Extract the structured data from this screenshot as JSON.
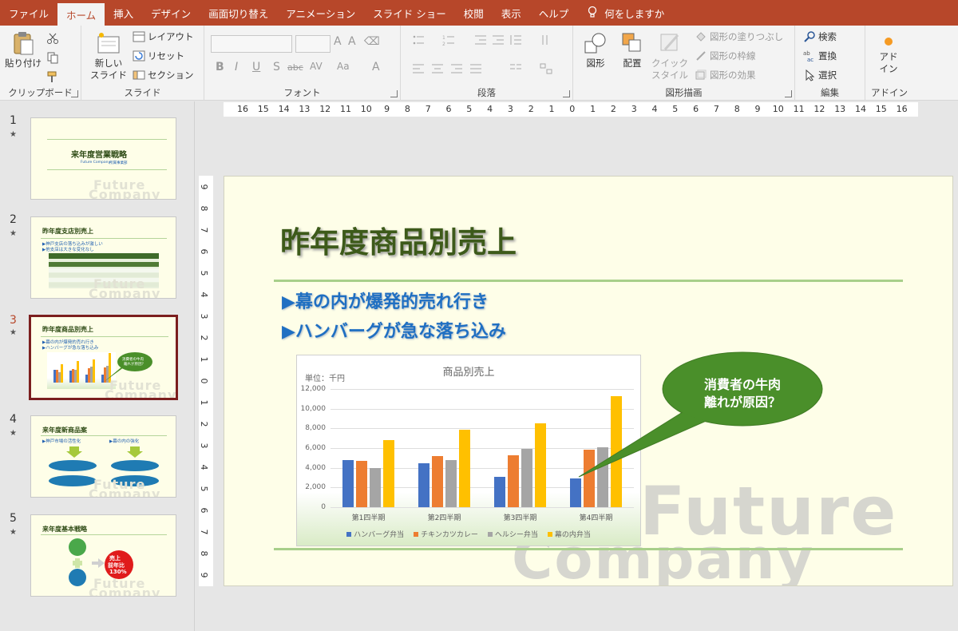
{
  "menu": {
    "tabs": [
      "ファイル",
      "ホーム",
      "挿入",
      "デザイン",
      "画面切り替え",
      "アニメーション",
      "スライド ショー",
      "校閲",
      "表示",
      "ヘルプ"
    ],
    "tell_me": "何をしますか"
  },
  "ribbon": {
    "clipboard": {
      "paste": "貼り付け",
      "label": "クリップボード"
    },
    "slides": {
      "new_slide_line1": "新しい",
      "new_slide_line2": "スライド",
      "layout": "レイアウト",
      "reset": "リセット",
      "section": "セクション",
      "label": "スライド"
    },
    "font": {
      "label": "フォント",
      "bold": "B",
      "italic": "I",
      "underline": "U",
      "shadow": "S",
      "strike": "abc",
      "spacing": "AV",
      "case": "Aa",
      "color": "A"
    },
    "paragraph": {
      "label": "段落"
    },
    "drawing": {
      "shapes": "図形",
      "arrange": "配置",
      "quick_line1": "クイック",
      "quick_line2": "スタイル",
      "fill": "図形の塗りつぶし",
      "outline": "図形の枠線",
      "effects": "図形の効果",
      "label": "図形描画"
    },
    "editing": {
      "find": "検索",
      "replace": "置換",
      "select": "選択",
      "label": "編集"
    },
    "addins": {
      "line1": "アド",
      "line2": "イン",
      "label": "アドイン"
    }
  },
  "thumbnails": [
    {
      "num": "1",
      "star": "★",
      "title": "来年度営業戦略",
      "sub1": "Future Company",
      "sub2": "所属事業部"
    },
    {
      "num": "2",
      "star": "★",
      "title": "昨年度支店別売上",
      "b1": "▶神戸支店の落ち込みが激しい",
      "b2": "▶他支店は大きな変化なし"
    },
    {
      "num": "3",
      "star": "★",
      "title": "昨年度商品別売上",
      "b1": "▶幕の内が爆発的売れ行き",
      "b2": "▶ハンバーグが急な落ち込み",
      "callout1": "消費者の牛肉",
      "callout2": "離れが原因？"
    },
    {
      "num": "4",
      "star": "★",
      "title": "来年度新商品案",
      "b1": "▶神戸市場の活性化",
      "b2": "▶幕の内の強化"
    },
    {
      "num": "5",
      "star": "★",
      "title": "来年度基本戦略",
      "circle1": "売上",
      "circle2": "前年比",
      "circle3": "130%"
    }
  ],
  "watermark": {
    "line1": "Future",
    "line2": "Company"
  },
  "rulers": {
    "h": [
      "16",
      "15",
      "14",
      "13",
      "12",
      "11",
      "10",
      "9",
      "8",
      "7",
      "6",
      "5",
      "4",
      "3",
      "2",
      "1",
      "0",
      "1",
      "2",
      "3",
      "4",
      "5",
      "6",
      "7",
      "8",
      "9",
      "10",
      "11",
      "12",
      "13",
      "14",
      "15",
      "16"
    ],
    "v": [
      "9",
      "8",
      "7",
      "6",
      "5",
      "4",
      "3",
      "2",
      "1",
      "0",
      "1",
      "2",
      "3",
      "4",
      "5",
      "6",
      "7",
      "8",
      "9"
    ]
  },
  "slide": {
    "title": "昨年度商品別売上",
    "bullets": [
      "▶幕の内が爆発的売れ行き",
      "▶ハンバーグが急な落ち込み"
    ],
    "callout": {
      "line1": "消費者の牛肉",
      "line2": "離れが原因？"
    }
  },
  "chart_data": {
    "type": "bar",
    "title": "商品別売上",
    "unit_label": "単位：千円",
    "categories": [
      "第1四半期",
      "第2四半期",
      "第3四半期",
      "第4四半期"
    ],
    "series": [
      {
        "name": "ハンバーグ弁当",
        "color": "#4472c4",
        "values": [
          4800,
          4500,
          3100,
          2900
        ]
      },
      {
        "name": "チキンカツカレー",
        "color": "#ed7d31",
        "values": [
          4700,
          5200,
          5300,
          5800
        ]
      },
      {
        "name": "ヘルシー弁当",
        "color": "#a5a5a5",
        "values": [
          4000,
          4800,
          5900,
          6100
        ]
      },
      {
        "name": "幕の内弁当",
        "color": "#ffc000",
        "values": [
          6800,
          7900,
          8500,
          11300
        ]
      }
    ],
    "ylim": [
      0,
      12000
    ],
    "yticks": [
      "0",
      "2,000",
      "4,000",
      "6,000",
      "8,000",
      "10,000",
      "12,000"
    ],
    "grid": true,
    "legend": "bottom"
  },
  "colors": {
    "accent": "#b7472a",
    "title_green": "#3d5a1a",
    "bullet_blue": "#1f6fc2",
    "callout_green": "#4a8f2a"
  }
}
